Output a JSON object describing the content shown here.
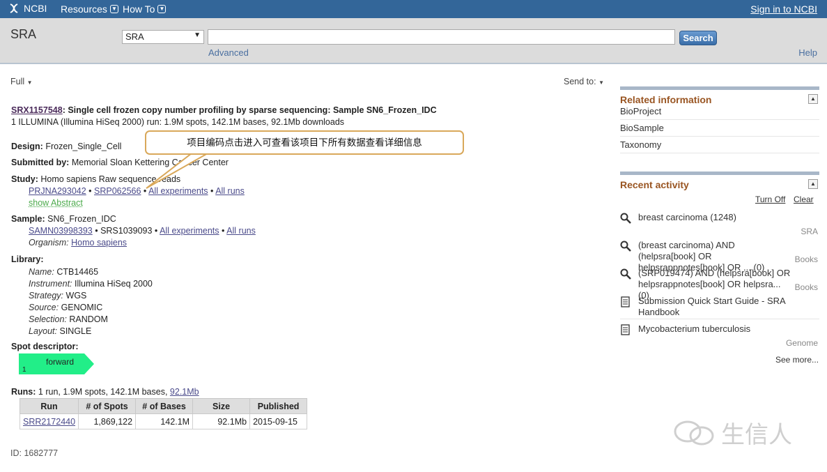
{
  "topbar": {
    "logo": "NCBI",
    "resources": "Resources",
    "howto": "How To",
    "signin": "Sign in to NCBI"
  },
  "search": {
    "title": "SRA",
    "db": "SRA",
    "button": "Search",
    "advanced": "Advanced",
    "help": "Help"
  },
  "view": {
    "format": "Full",
    "sendto": "Send to:"
  },
  "record": {
    "accession": "SRX1157548",
    "title_rest": ": Single cell frozen copy number profiling by sparse sequencing: Sample SN6_Frozen_IDC",
    "summary": "1 ILLUMINA (Illumina HiSeq 2000) run: 1.9M spots, 142.1M bases, 92.1Mb downloads",
    "design_label": "Design:",
    "design": "Frozen_Single_Cell",
    "submitted_label": "Submitted by:",
    "submitted": "Memorial Sloan Kettering Cancer Center",
    "study_label": "Study:",
    "study": "Homo sapiens Raw sequence reads",
    "study_links": [
      "PRJNA293042",
      "SRP062566",
      "All experiments",
      "All runs"
    ],
    "show_abstract": "show Abstract",
    "sample_label": "Sample:",
    "sample": "SN6_Frozen_IDC",
    "sample_link1": "SAMN03998393",
    "sample_text2": "SRS1039093",
    "sample_links": [
      "All experiments",
      "All runs"
    ],
    "organism_label": "Organism:",
    "organism": "Homo sapiens",
    "library_label": "Library:",
    "library": [
      {
        "label": "Name:",
        "value": "CTB14465"
      },
      {
        "label": "Instrument:",
        "value": "Illumina HiSeq 2000"
      },
      {
        "label": "Strategy:",
        "value": "WGS"
      },
      {
        "label": "Source:",
        "value": "GENOMIC"
      },
      {
        "label": "Selection:",
        "value": "RANDOM"
      },
      {
        "label": "Layout:",
        "value": "SINGLE"
      }
    ],
    "spot_label": "Spot descriptor:",
    "spot_read": "forward",
    "spot_index": "1",
    "runs_label": "Runs:",
    "runs_summary": "1 run, 1.9M spots, 142.1M bases,",
    "runs_size_link": "92.1Mb",
    "runs_table": {
      "headers": [
        "Run",
        "# of Spots",
        "# of Bases",
        "Size",
        "Published"
      ],
      "rows": [
        [
          "SRR2172440",
          "1,869,122",
          "142.1M",
          "92.1Mb",
          "2015-09-15"
        ]
      ]
    },
    "id": "ID: 1682777"
  },
  "callout": "项目编码点击进入可查看该项目下所有数据查看详细信息",
  "related": {
    "title": "Related information",
    "items": [
      "BioProject",
      "BioSample",
      "Taxonomy"
    ]
  },
  "recent": {
    "title": "Recent activity",
    "turnoff": "Turn Off",
    "clear": "Clear",
    "items": [
      {
        "text": "breast carcinoma (1248)",
        "db": "SRA"
      },
      {
        "text": "(breast carcinoma) AND (helpsra[book] OR helpsrappnotes[book] OR ... (0)",
        "db": "Books"
      },
      {
        "text": "(SRP019474) AND (helpsra[book] OR helpsrappnotes[book] OR helpsra... (0)",
        "db": "Books"
      },
      {
        "text": "Submission Quick Start Guide - SRA Handbook",
        "db": ""
      },
      {
        "text": "Mycobacterium tuberculosis",
        "db": "Genome"
      }
    ],
    "see_more": "See more..."
  },
  "watermark": "生信人",
  "colors": {
    "topbar": "#336699",
    "accent": "#995522",
    "spot": "#22ee88"
  }
}
